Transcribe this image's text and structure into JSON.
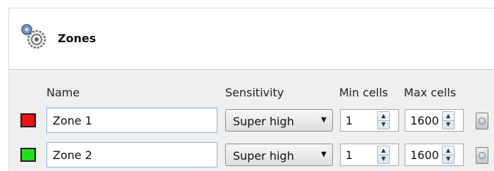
{
  "header": {
    "title": "Zones",
    "icon": "gears-icon"
  },
  "columns": {
    "name": "Name",
    "sensitivity": "Sensitivity",
    "min_cells": "Min cells",
    "max_cells": "Max cells"
  },
  "zones": [
    {
      "color": "#ee1111",
      "name": "Zone 1",
      "sensitivity": "Super high",
      "min_cells": "1",
      "max_cells": "1600"
    },
    {
      "color": "#22dd22",
      "name": "Zone 2",
      "sensitivity": "Super high",
      "min_cells": "1",
      "max_cells": "1600"
    }
  ],
  "icons": {
    "delete": "delete-zone-icon",
    "dropdown": "chevron-down-icon",
    "spin_up": "spin-up-icon",
    "spin_down": "spin-down-icon"
  }
}
